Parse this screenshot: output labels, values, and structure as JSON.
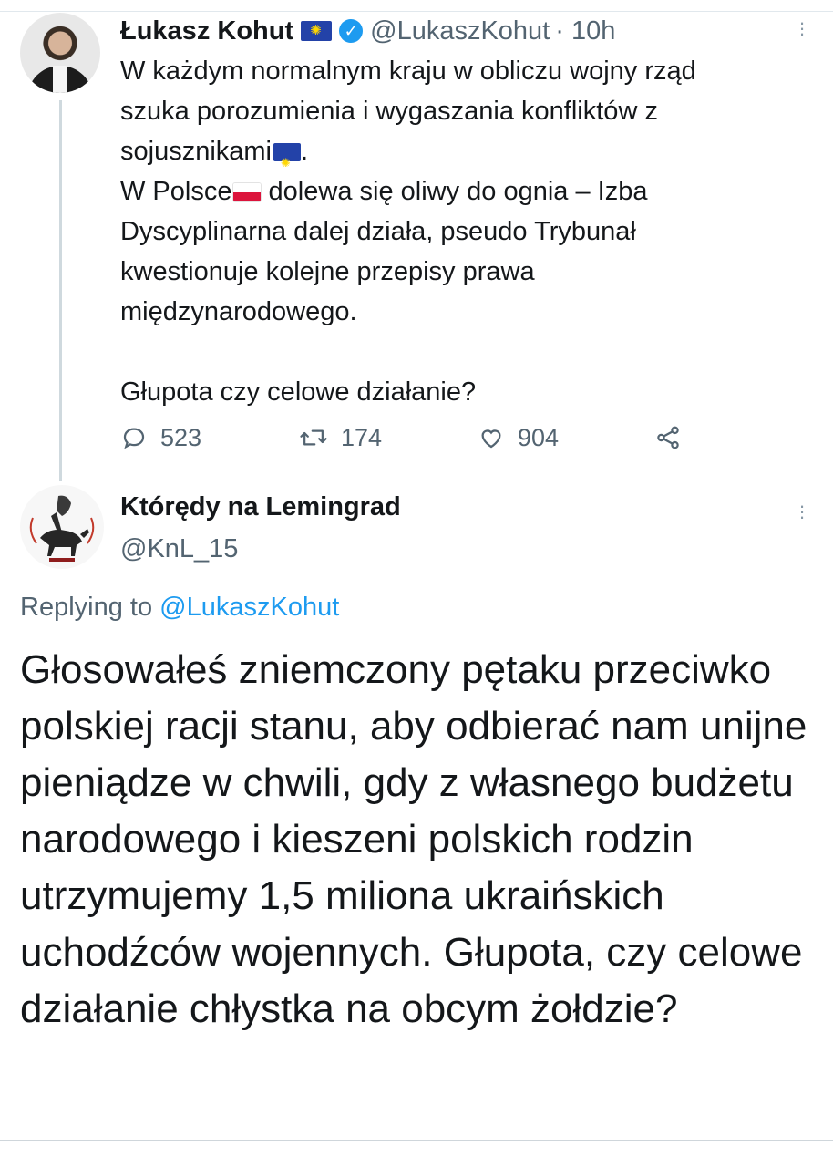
{
  "tweet1": {
    "author_name": "Łukasz Kohut",
    "author_handle": "@LukaszKohut",
    "time": "· 10h",
    "lines": [
      "W każdym normalnym kraju w obliczu wojny rząd",
      "szuka porozumienia i wygaszania konfliktów z",
      "sojusznikami",
      ".",
      "W Polsce",
      " dolewa się oliwy do ognia – Izba",
      "Dyscyplinarna dalej działa, pseudo Trybunał",
      "kwestionuje kolejne przepisy prawa",
      "międzynarodowego.",
      "Głupota czy celowe działanie?"
    ],
    "replies": "523",
    "retweets": "174",
    "likes": "904",
    "icons": {
      "reply": "reply-icon",
      "retweet": "retweet-icon",
      "like": "heart-icon",
      "share": "share-icon",
      "more": "more-options-icon",
      "verified": "verified-badge-icon"
    },
    "colors": {
      "verified": "#1d9bf0",
      "eu_flag": "#2342a8"
    }
  },
  "tweet2": {
    "author_name": "Którędy na Lemingrad",
    "author_handle": "@KnL_15",
    "replying_prefix": "Replying to",
    "replying_to": "@LukaszKohut",
    "text": "Głosowałeś zniemczony pętaku przeciwko polskiej racji stanu, aby odbierać nam unijne pieniądze w chwili, gdy z własnego budżetu narodowego i kieszeni polskich rodzin utrzymujemy 1,5 miliona ukraińskich uchodźców wojennych. Głupota, czy celowe działanie chłystka na obcym żołdzie?",
    "colors": {
      "link": "#1d9bf0",
      "muted": "#536471"
    }
  }
}
